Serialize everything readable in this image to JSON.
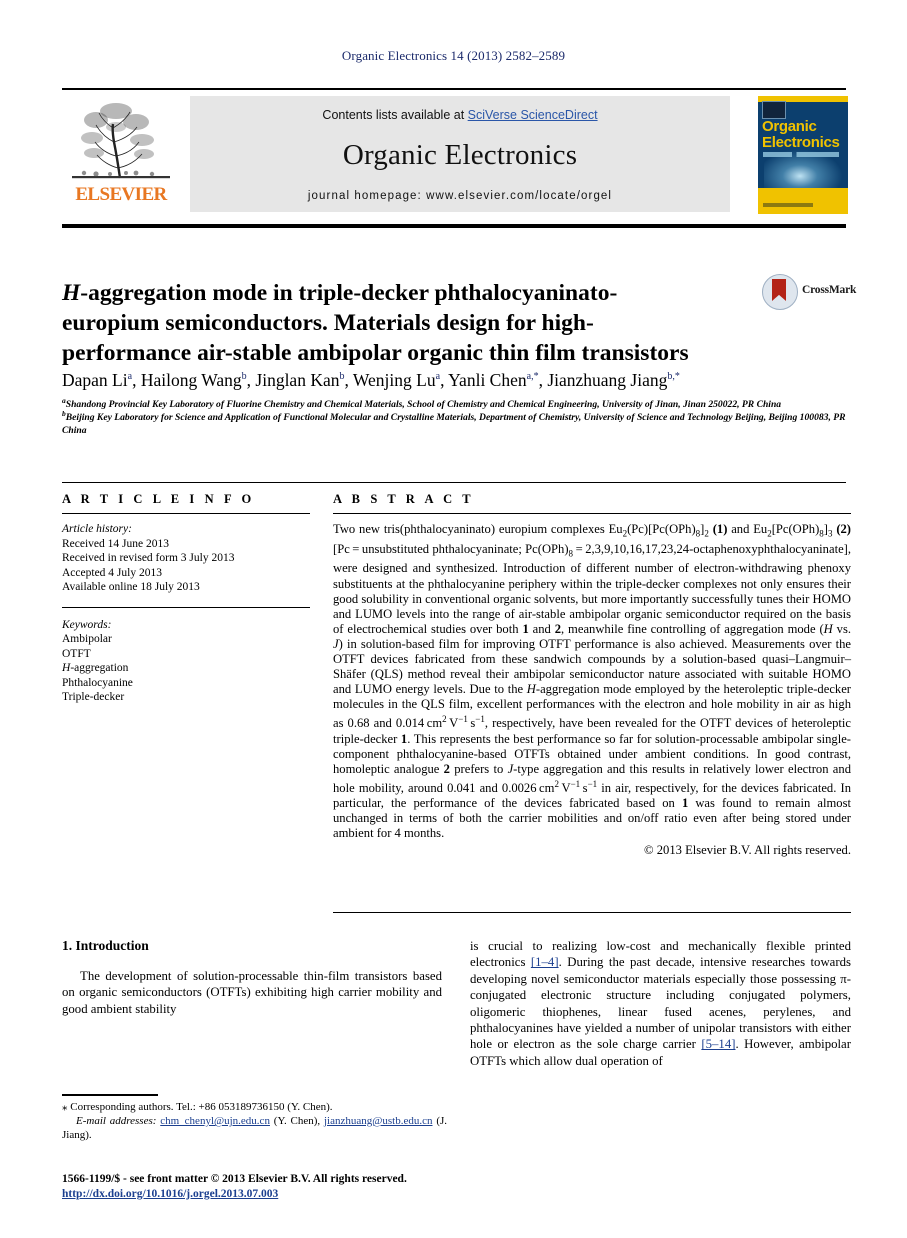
{
  "running_head": "Organic Electronics 14 (2013) 2582–2589",
  "banner": {
    "contents_prefix": "Contents lists available at ",
    "contents_link": "SciVerse ScienceDirect",
    "journal_name": "Organic Electronics",
    "homepage": "journal homepage: www.elsevier.com/locate/orgel",
    "publisher_logo_text": "ELSEVIER",
    "cover_title_line1": "Organic",
    "cover_title_line2": "Electronics"
  },
  "article": {
    "title_part_italic": "H",
    "title_rest": "-aggregation mode in triple-decker phthalocyaninato-europium semiconductors. Materials design for high-performance air-stable ambipolar organic thin film transistors",
    "crossmark_label": "CrossMark",
    "authors": [
      {
        "name": "Dapan Li",
        "sup": "a"
      },
      {
        "name": "Hailong Wang",
        "sup": "b"
      },
      {
        "name": "Jinglan Kan",
        "sup": "b"
      },
      {
        "name": "Wenjing Lu",
        "sup": "a"
      },
      {
        "name": "Yanli Chen",
        "sup": "a,*"
      },
      {
        "name": "Jianzhuang Jiang",
        "sup": "b,*"
      }
    ],
    "affiliations": [
      {
        "marker": "a",
        "text": "Shandong Provincial Key Laboratory of Fluorine Chemistry and Chemical Materials, School of Chemistry and Chemical Engineering, University of Jinan, Jinan 250022, PR China"
      },
      {
        "marker": "b",
        "text": "Beijing Key Laboratory for Science and Application of Functional Molecular and Crystalline Materials, Department of Chemistry, University of Science and Technology Beijing, Beijing 100083, PR China"
      }
    ]
  },
  "article_info": {
    "heading": "A R T I C L E   I N F O",
    "history_label": "Article history:",
    "history": [
      "Received 14 June 2013",
      "Received in revised form 3 July 2013",
      "Accepted 4 July 2013",
      "Available online 18 July 2013"
    ],
    "keywords_label": "Keywords:",
    "keywords": [
      "Ambipolar",
      "OTFT",
      "H-aggregation",
      "Phthalocyanine",
      "Triple-decker"
    ]
  },
  "abstract": {
    "heading": "A B S T R A C T",
    "copyright": "© 2013 Elsevier B.V. All rights reserved."
  },
  "body": {
    "section_title": "1. Introduction",
    "left_paragraph": "The development of solution-processable thin-film transistors based on organic semiconductors (OTFTs) exhibiting high carrier mobility and good ambient stability",
    "right_paragraph_a": "is crucial to realizing low-cost and mechanically flexible printed electronics ",
    "right_ref_1": "[1–4]",
    "right_paragraph_b": ". During the past decade, intensive researches towards developing novel semiconductor materials especially those possessing π-conjugated electronic structure including conjugated polymers, oligomeric thiophenes, linear fused acenes, perylenes, and phthalocyanines have yielded a number of unipolar transistors with either hole or electron as the sole charge carrier ",
    "right_ref_2": "[5–14]",
    "right_paragraph_c": ". However, ambipolar OTFTs which allow dual operation of"
  },
  "footnotes": {
    "corresponding": "Corresponding authors. Tel.: +86 053189736150 (Y. Chen).",
    "email_label": "E-mail addresses:",
    "email1": "chm_chenyl@ujn.edu.cn",
    "email1_who": "(Y. Chen),",
    "email2": "jianzhuang@ustb.edu.cn",
    "email2_who": "(J. Jiang)."
  },
  "imprint": {
    "line1": "1566-1199/$ - see front matter © 2013 Elsevier B.V. All rights reserved.",
    "doi": "http://dx.doi.org/10.1016/j.orgel.2013.07.003"
  },
  "colors": {
    "link_blue": "#1b3f8f",
    "heading_blue": "#1b2a6b",
    "elsevier_orange": "#e87722",
    "banner_gray": "#e6e6e6",
    "cover_blue": "#0c3f6e",
    "cover_yellow": "#f0c200",
    "crossmark_red": "#b32317"
  }
}
